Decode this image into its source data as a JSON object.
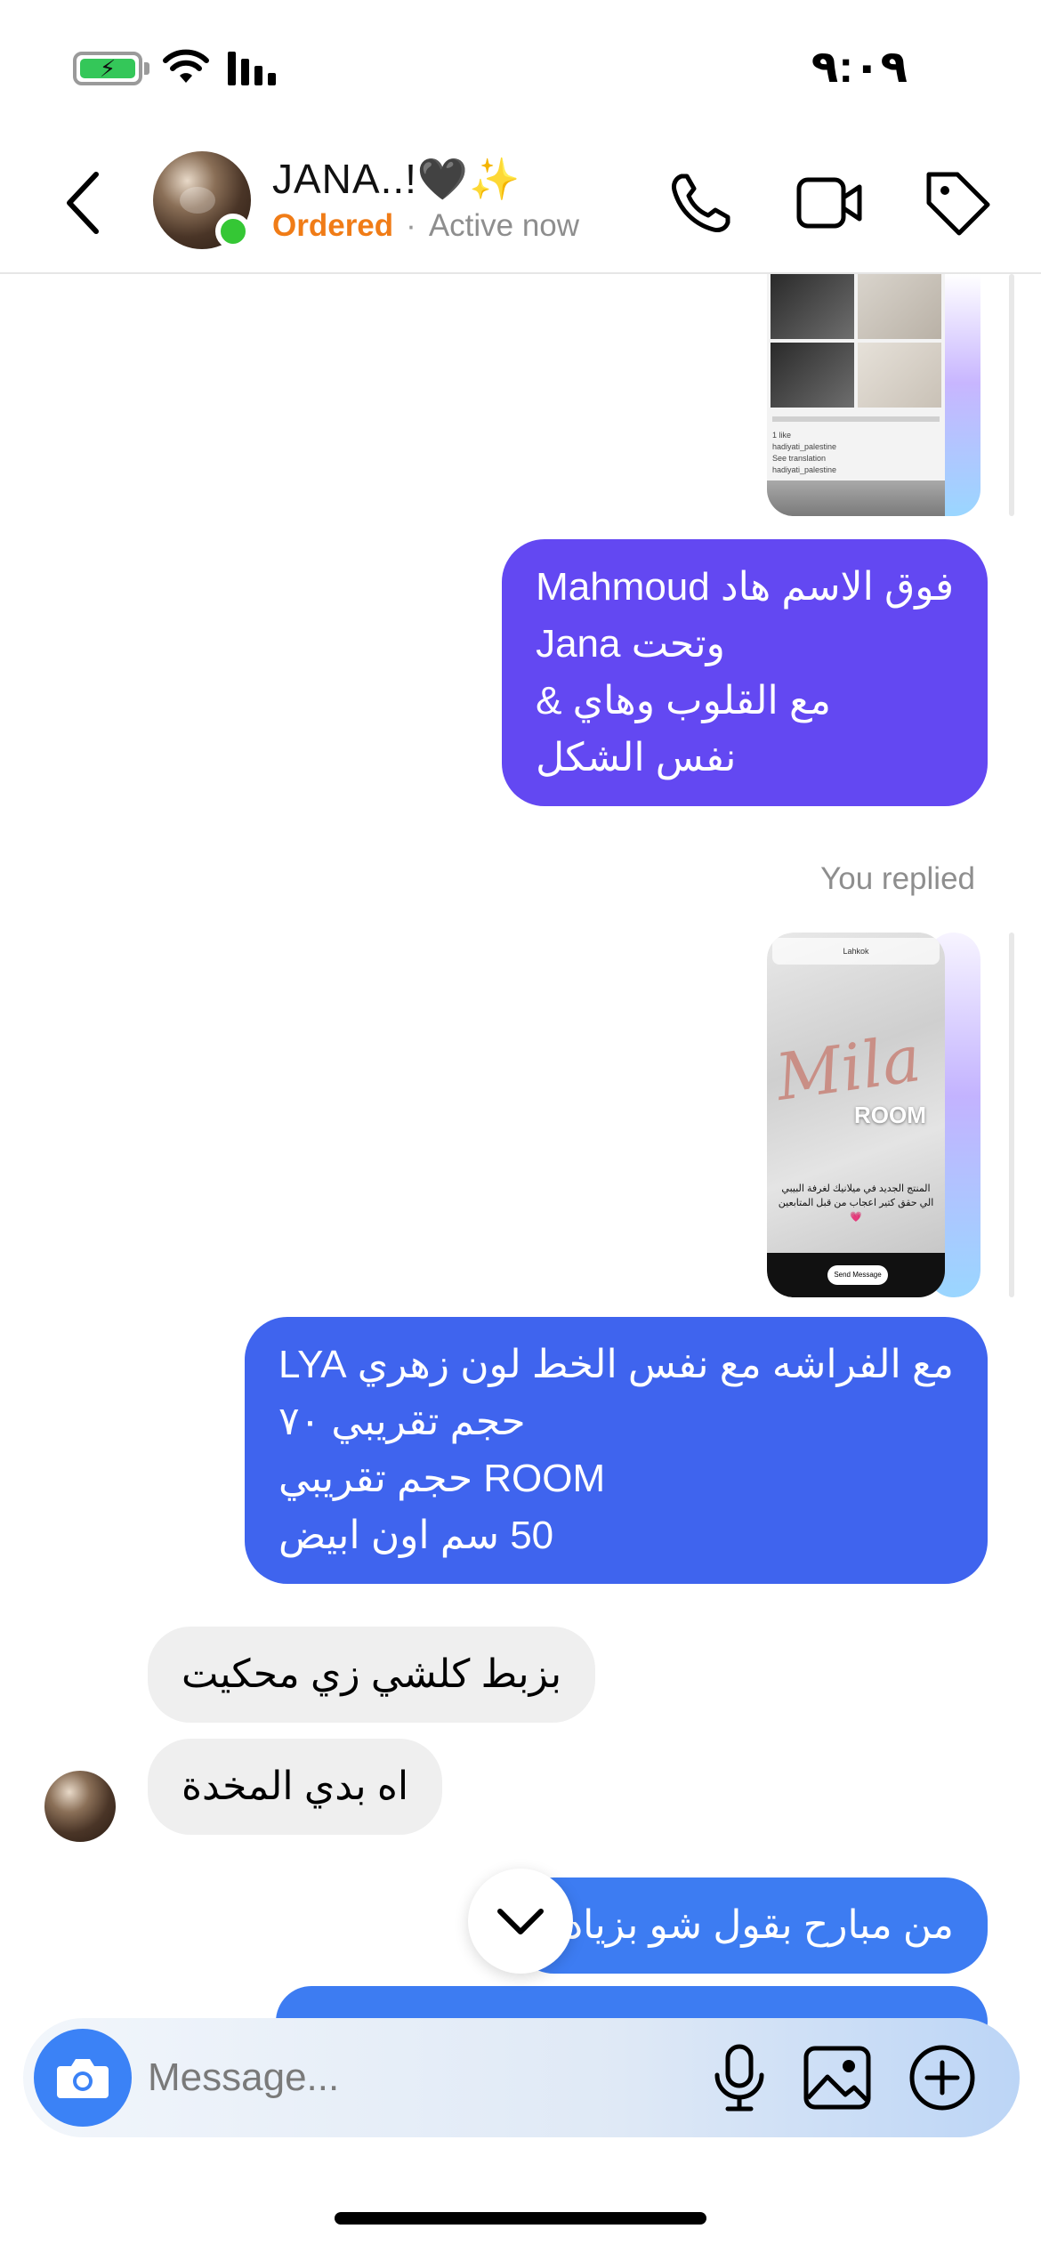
{
  "status_bar": {
    "time": "٩:٠٩",
    "battery_icon": "battery-charging-icon",
    "wifi_icon": "wifi-icon",
    "signal_icon": "signal-icon"
  },
  "header": {
    "contact_name": "JANA..!🖤✨",
    "label": "Ordered",
    "separator": "·",
    "presence": "Active now",
    "icons": {
      "back": "chevron-left-icon",
      "call": "phone-icon",
      "video": "video-camera-icon",
      "tag": "tag-icon"
    },
    "colors": {
      "label": "#f07c17",
      "online": "#35c735"
    }
  },
  "messages": {
    "story_1": {
      "like_text": "1 like",
      "caption": "hadiyati_palestine",
      "see_translation": "See translation",
      "account": "hadiyati_palestine"
    },
    "outgoing_1": {
      "lines": [
        "فوق الاسم هاد Mahmoud",
        "وتحت Jana",
        "مع القلوب وهاي &",
        "نفس الشكل"
      ],
      "color": "#6348f2"
    },
    "you_replied": "You replied",
    "story_2": {
      "account": "Lahkok",
      "room_text": "ROOM",
      "script_text": "Mila",
      "description": "المنتج الجديد في ميلانيك لغرفة البيبي الي حقق كتير اعجاب من قبل المتابعين 💗",
      "send_message": "Send Message"
    },
    "outgoing_2": {
      "lines": [
        "مع الفراشه مع نفس الخط لون زهري LYA",
        "حجم تقريبي ٧٠",
        "ROOM حجم تقريبي",
        "50 سم اون ابيض"
      ],
      "color": "#3f64ee"
    },
    "incoming_1": "بزبط كلشي زي محكيت",
    "incoming_2": "اه بدي المخدة",
    "outgoing_3": {
      "text": "من مبارح بقول شو بزياده",
      "color": "#3d7cf2"
    }
  },
  "scroll_down_icon": "chevron-down-icon",
  "composer": {
    "placeholder": "Message...",
    "icons": {
      "camera": "camera-icon",
      "mic": "microphone-icon",
      "gallery": "image-icon",
      "add": "plus-circle-icon"
    },
    "camera_color": "#3b82f6"
  }
}
